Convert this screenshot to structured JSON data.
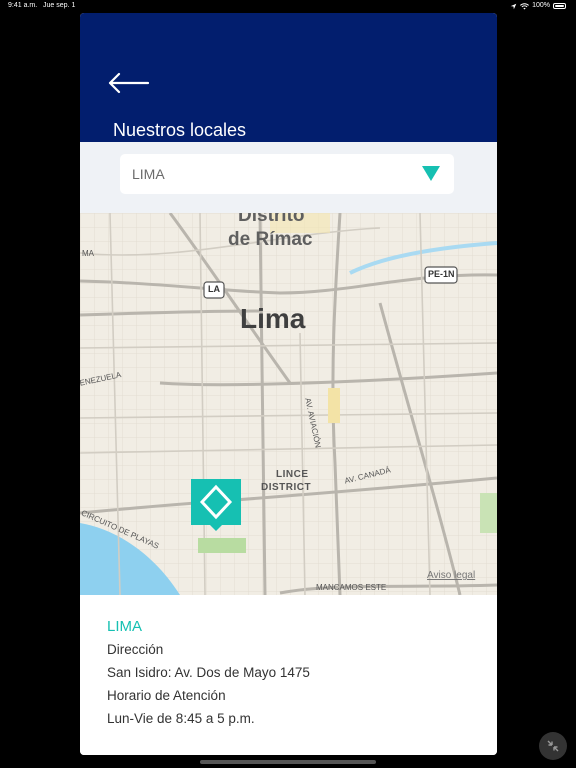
{
  "status_bar": {
    "time": "9:41 a.m.",
    "date": "Jue sep. 1",
    "battery": "100%"
  },
  "header": {
    "title": "Nuestros locales"
  },
  "selector": {
    "selected": "LIMA"
  },
  "map": {
    "labels": {
      "distrito": "Distrito",
      "rimac": "de Rímac",
      "city": "Lima",
      "lince": "LINCE",
      "district": "DISTRICT",
      "aviacion": "AV. AVIACIÓN",
      "canada": "AV. CANADÁ",
      "venezuela": "VENEZUELA",
      "playas": "CIRCUITO DE PLAYAS",
      "mancamos": "MANCAMOS ESTE",
      "ma": "MA",
      "la_shield": "LA",
      "pe_shield": "PE-1N"
    },
    "legal": "Aviso legal"
  },
  "info": {
    "city": "LIMA",
    "address_label": "Dirección",
    "address": "San Isidro: Av. Dos de Mayo 1475",
    "hours_label": "Horario de Atención",
    "hours": "Lun-Vie de 8:45 a 5 p.m."
  },
  "colors": {
    "header": "#021e6e",
    "accent": "#16c0b2",
    "selector_bg": "#eff2f6"
  }
}
